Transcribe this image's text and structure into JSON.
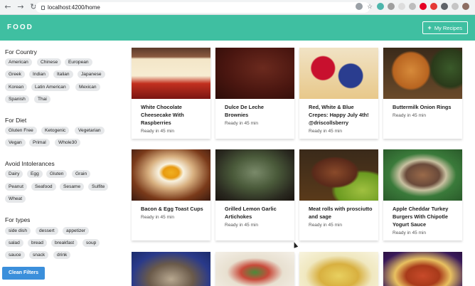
{
  "browser": {
    "url": "localhost:4200/home"
  },
  "header": {
    "logo": "FOOD",
    "my_recipes_label": "My Recipes"
  },
  "sidebar": {
    "sections": [
      {
        "title": "For Country",
        "chips": [
          "American",
          "Chinese",
          "European",
          "Greek",
          "Indian",
          "Italian",
          "Japanese",
          "Korean",
          "Latin American",
          "Mexican",
          "Spanish",
          "Thai"
        ]
      },
      {
        "title": "For Diet",
        "chips": [
          "Gluten Free",
          "Ketogenic",
          "Vegetarian",
          "Vegan",
          "Primal",
          "Whole30"
        ]
      },
      {
        "title": "Avoid Intolerances",
        "chips": [
          "Dairy",
          "Egg",
          "Gluten",
          "Grain",
          "Peanut",
          "Seafood",
          "Sesame",
          "Sulfite",
          "Wheat"
        ]
      },
      {
        "title": "For types",
        "chips": [
          "side dish",
          "dessert",
          "appetizer",
          "salad",
          "bread",
          "breakfast",
          "soup",
          "sauce",
          "snack",
          "drink"
        ]
      }
    ],
    "clean_filters_label": "Clean Filters"
  },
  "recipes": [
    {
      "title": "White Chocolate Cheesecake With Raspberries",
      "meta": "Ready in 45 min"
    },
    {
      "title": "Dulce De Leche Brownies",
      "meta": "Ready in 45 min"
    },
    {
      "title": "Red, White & Blue Crepes: Happy July 4th! @driscollsberry",
      "meta": "Ready in 45 min"
    },
    {
      "title": "Buttermilk Onion Rings",
      "meta": "Ready in 45 min"
    },
    {
      "title": "Bacon & Egg Toast Cups",
      "meta": "Ready in 45 min"
    },
    {
      "title": "Grilled Lemon Garlic Artichokes",
      "meta": "Ready in 45 min"
    },
    {
      "title": "Meat rolls with prosciutto and sage",
      "meta": "Ready in 45 min"
    },
    {
      "title": "Apple Cheddar Turkey Burgers With Chipotle Yogurt Sauce",
      "meta": "Ready in 45 min"
    }
  ],
  "colors": {
    "header": "#3fbfa1",
    "button": "#3b8fdb",
    "chip": "#e6e8ea"
  }
}
